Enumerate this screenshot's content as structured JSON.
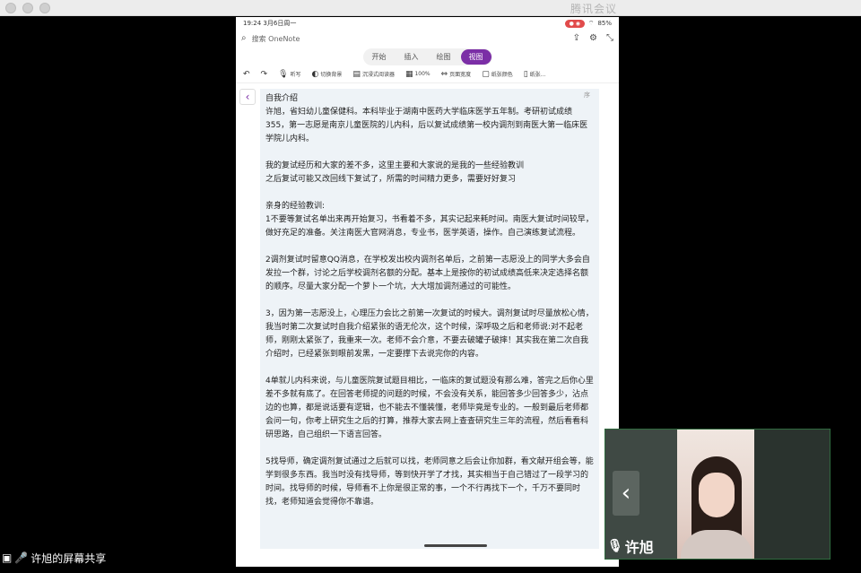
{
  "window": {
    "app_title": "腾讯会议"
  },
  "phone": {
    "status": {
      "time": "19:24",
      "date": "3月6日周一",
      "battery": "85%"
    },
    "search": {
      "placeholder": "搜索 OneNote"
    },
    "tabs": [
      {
        "label": "开始",
        "active": false
      },
      {
        "label": "插入",
        "active": false
      },
      {
        "label": "绘图",
        "active": false
      },
      {
        "label": "视图",
        "active": true
      }
    ],
    "toolbar": [
      {
        "icon": "undo-icon",
        "label": ""
      },
      {
        "icon": "redo-icon",
        "label": ""
      },
      {
        "icon": "dictate-icon",
        "label": "听写"
      },
      {
        "icon": "switch-bg-icon",
        "label": "切换背景"
      },
      {
        "icon": "immersive-reader-icon",
        "label": "沉浸式阅读器"
      },
      {
        "icon": "zoom-icon",
        "label": "100%"
      },
      {
        "icon": "page-width-icon",
        "label": "页面宽度"
      },
      {
        "icon": "page-color-icon",
        "label": "纸张颜色"
      },
      {
        "icon": "paper-style-icon",
        "label": "纸张..."
      }
    ],
    "note": {
      "corner": "序",
      "title": "自我介绍",
      "paragraphs": [
        "许旭，省妇幼儿童保健科。本科毕业于湖南中医药大学临床医学五年制。考研初试成绩355，第一志愿是南京儿童医院的儿内科，后以复试成绩第一校内调剂到南医大第一临床医学院儿内科。",
        "我的复试经历和大家的差不多，这里主要和大家说的是我的一些经验教训\n之后复试可能又改回线下复试了，所需的时间精力更多，需要好好复习",
        "亲身的经验教训:\n1不要等复试名单出来再开始复习，书看着不多，其实记起来耗时间。南医大复试时间较早，做好充足的准备。关注南医大官网消息，专业书，医学英语，操作。自己演练复试流程。",
        "2调剂复试时留意QQ消息，在学校发出校内调剂名单后，之前第一志愿没上的同学大多会自发拉一个群，讨论之后学校调剂名额的分配。基本上是按你的初试成绩高低来决定选择名额的顺序。尽量大家分配一个萝卜一个坑，大大增加调剂通过的可能性。",
        "3，因为第一志愿没上，心理压力会比之前第一次复试的时候大。调剂复试时尽量放松心情，我当时第二次复试时自我介绍紧张的语无伦次，这个时候，深呼吸之后和老师说:对不起老师，刚刚太紧张了，我重来一次。老师不会介意，不要去破罐子破摔！其实我在第二次自我介绍时，已经紧张到眼前发黑，一定要撑下去说完你的内容。",
        "4单就儿内科来说，与儿童医院复试题目相比，一临床的复试题没有那么难，答完之后你心里差不多就有底了。在回答老师提的问题的时候，不会没有关系，能回答多少回答多少，沾点边的也算，都是说话要有逻辑，也不能去不懂装懂，老师毕竟是专业的。一般到最后老师都会问一句，你考上研究生之后的打算，推荐大家去网上查查研究生三年的流程，然后看看科研思路，自己组织一下语言回答。",
        "5找导师，确定调剂复试通过之后就可以找，老师同意之后会让你加群，看文献开组会等，能学到很多东西。我当时没有找导师，等到快开学了才找，其实相当于自己错过了一段学习的时间。找导师的时候，导师看不上你是很正常的事，一个不行再找下一个，千万不要同时找，老师知道会觉得你不靠谱。"
      ]
    }
  },
  "webcam": {
    "name": "许旭"
  },
  "share_bar": {
    "caption": "许旭的屏幕共享"
  }
}
